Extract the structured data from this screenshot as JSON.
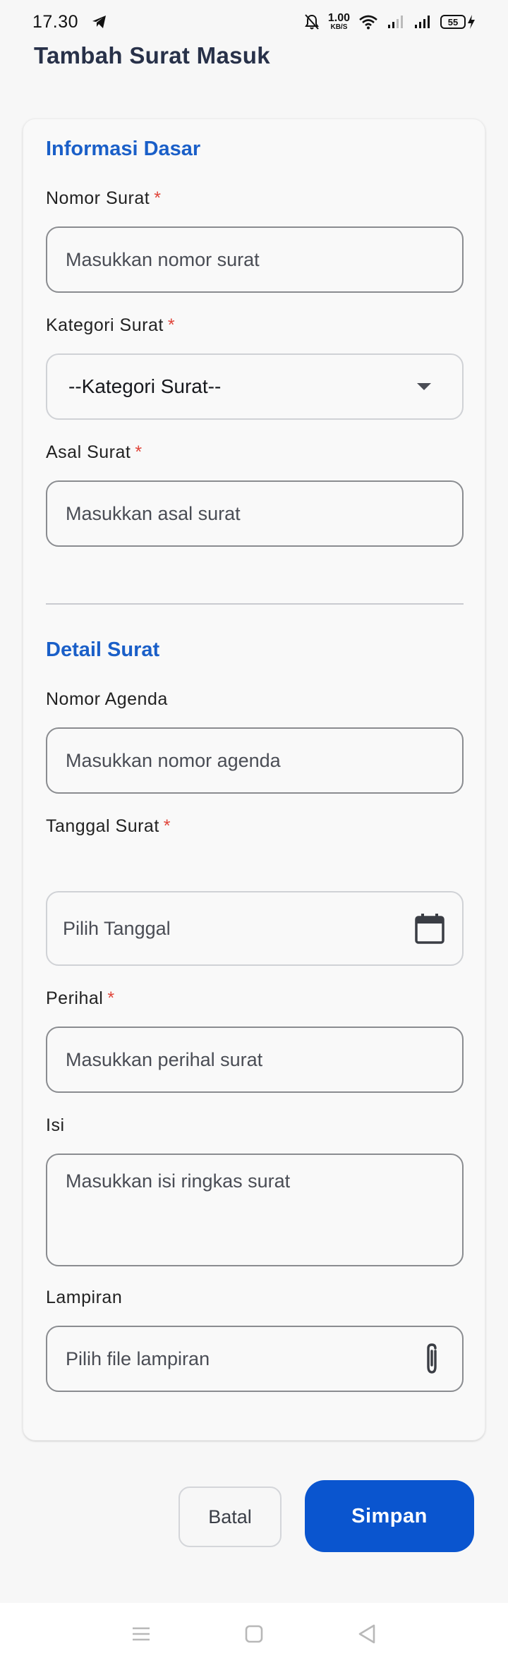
{
  "status_bar": {
    "time": "17.30",
    "net_speed_value": "1.00",
    "net_speed_unit": "KB/S",
    "battery": "55"
  },
  "header": {
    "title": "Tambah Surat Masuk"
  },
  "form": {
    "section_basic": "Informasi Dasar",
    "nomor_surat": {
      "label": "Nomor Surat",
      "placeholder": "Masukkan nomor surat",
      "required": "*"
    },
    "kategori_surat": {
      "label": "Kategori Surat",
      "value": "--Kategori Surat--",
      "required": "*"
    },
    "asal_surat": {
      "label": "Asal Surat",
      "placeholder": "Masukkan asal surat",
      "required": "*"
    },
    "section_detail": "Detail Surat",
    "nomor_agenda": {
      "label": "Nomor Agenda",
      "placeholder": "Masukkan nomor agenda"
    },
    "tanggal_surat": {
      "label": "Tanggal Surat",
      "placeholder": "Pilih Tanggal",
      "required": "*"
    },
    "perihal": {
      "label": "Perihal",
      "placeholder": "Masukkan perihal surat",
      "required": "*"
    },
    "isi": {
      "label": "Isi",
      "placeholder": "Masukkan isi ringkas surat"
    },
    "lampiran": {
      "label": "Lampiran",
      "placeholder": "Pilih file lampiran"
    }
  },
  "actions": {
    "cancel_label": "Batal",
    "save_label": "Simpan"
  },
  "colors": {
    "accent": "#0a55cf",
    "section_title": "#1a5fc8",
    "required": "#e0453a",
    "title": "#283149"
  }
}
